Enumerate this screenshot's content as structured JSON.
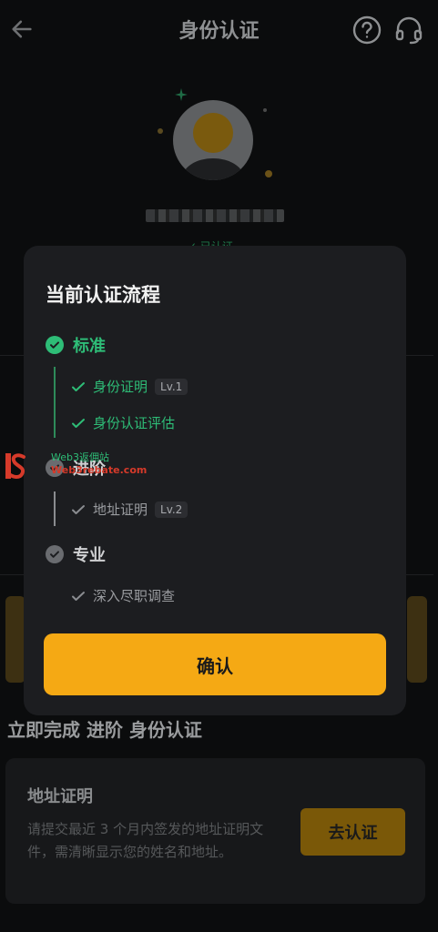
{
  "header": {
    "title": "身份认证"
  },
  "profile": {
    "verified_chip": "✓ 已认证"
  },
  "modal": {
    "title": "当前认证流程",
    "levels": [
      {
        "label": "标准",
        "status": "completed",
        "items": [
          {
            "label": "身份证明",
            "badge": "Lv.1"
          },
          {
            "label": "身份认证评估",
            "badge": ""
          }
        ]
      },
      {
        "label": "进阶",
        "status": "pending",
        "items": [
          {
            "label": "地址证明",
            "badge": "Lv.2"
          }
        ]
      },
      {
        "label": "专业",
        "status": "pending",
        "items": [
          {
            "label": "深入尽职调查",
            "badge": ""
          }
        ]
      }
    ],
    "confirm_label": "确认"
  },
  "page": {
    "complete_heading": "立即完成 进阶 身份认证",
    "address_card": {
      "title": "地址证明",
      "description": "请提交最近 3 个月内签发的地址证明文件，需清晰显示您的姓名和地址。",
      "button": "去认证"
    }
  },
  "watermark": {
    "line1": "Web3返佣站",
    "line2": "Web3rebate.com"
  },
  "colors": {
    "accent": "#f5a914",
    "success": "#2ebd77",
    "modal_bg": "#1c1d20",
    "page_bg": "#0b0c0d"
  }
}
